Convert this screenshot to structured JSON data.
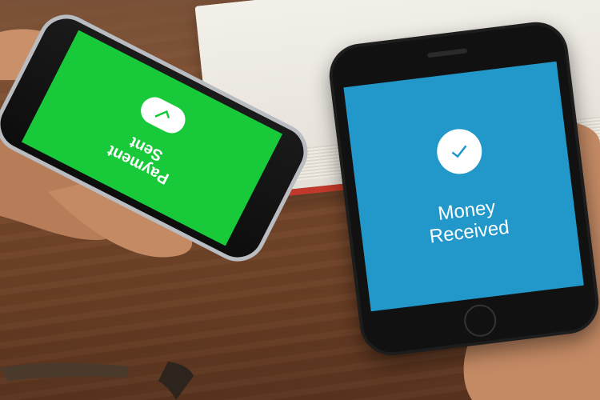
{
  "scene": {
    "left_phone": {
      "message_lines": [
        "Payment",
        "Sent"
      ],
      "screen_color": "#18c93a"
    },
    "right_phone": {
      "message_lines": [
        "Money",
        "Received"
      ],
      "screen_color": "#2198c9"
    },
    "icon": "check-icon"
  }
}
